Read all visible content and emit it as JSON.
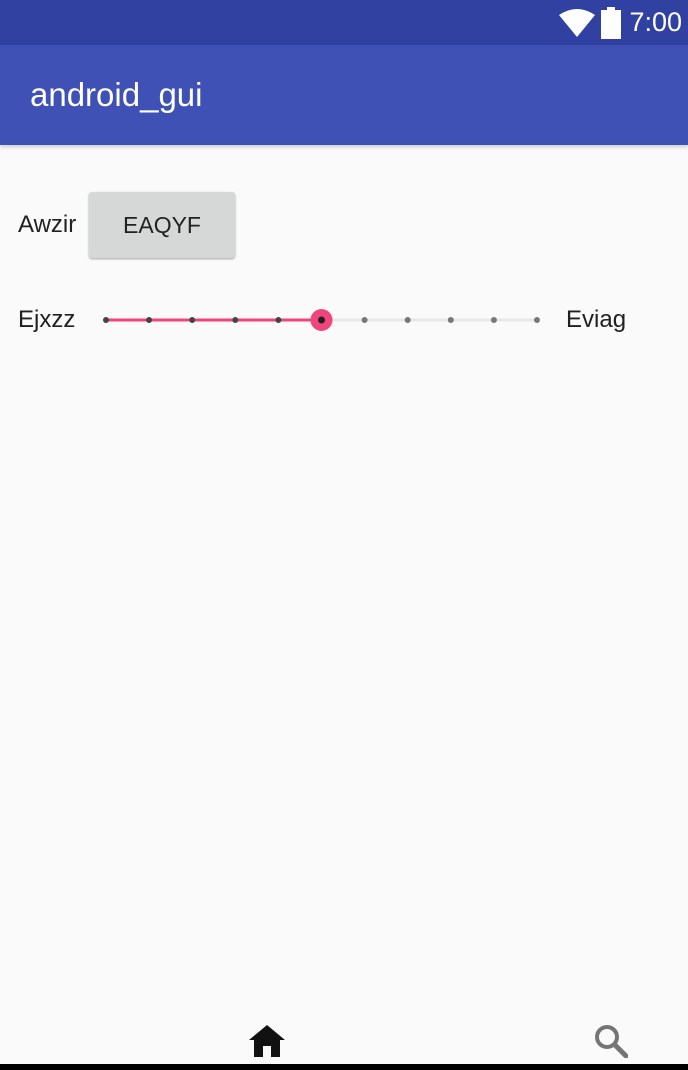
{
  "status_bar": {
    "time": "7:00",
    "icons": [
      "wifi-icon",
      "battery-icon"
    ]
  },
  "app_bar": {
    "title": "android_gui"
  },
  "form": {
    "row1_label": "Awzir",
    "button_label": "EAQYF",
    "slider_min_label": "Ejxzz",
    "slider_max_label": "Eviag",
    "slider": {
      "steps": 10,
      "value": 5,
      "accent_color": "#f0457c",
      "track_color": "#e8e8e8",
      "tick_color": "#555555"
    }
  },
  "nav_bar": {
    "items": [
      "home-icon",
      "search-icon"
    ]
  },
  "colors": {
    "status_bar": "#3041a2",
    "app_bar": "#3f51b5",
    "background": "#fafafa",
    "button": "#d6d7d7"
  }
}
